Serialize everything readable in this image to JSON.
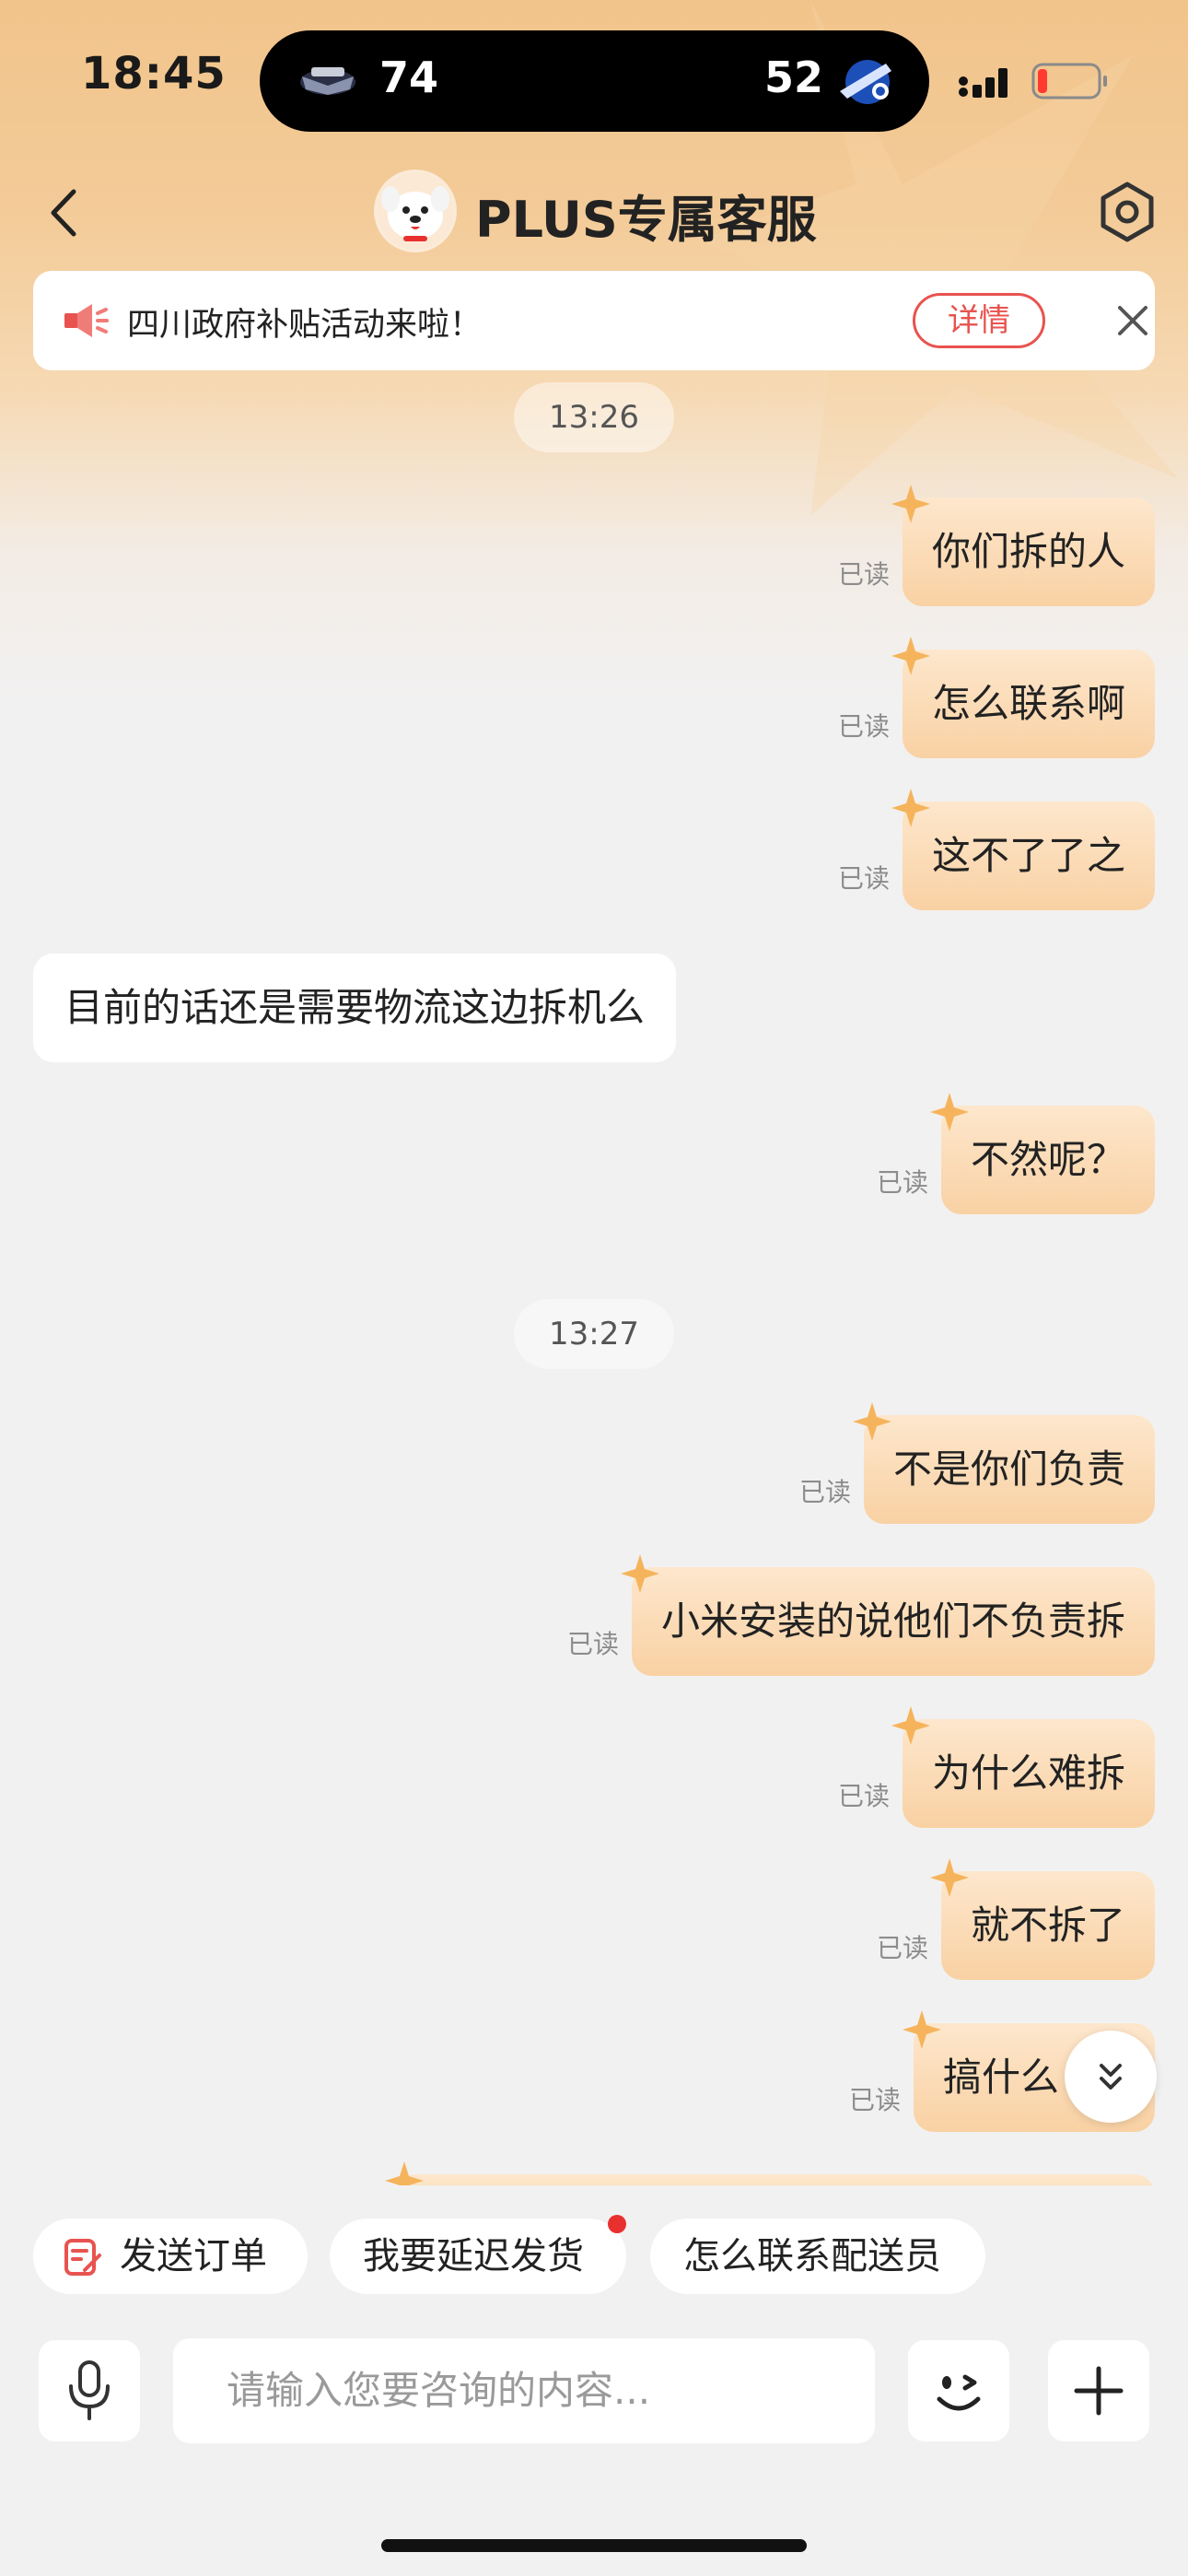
{
  "status_bar": {
    "time": "18:45",
    "live_activity": {
      "home_score": "74",
      "away_score": "52"
    }
  },
  "nav": {
    "title": "PLUS专属客服",
    "back_icon": "chevron-left-icon",
    "settings_icon": "hexagon-settings-icon"
  },
  "notice": {
    "text": "四川政府补贴活动来啦！",
    "detail_label": "详情",
    "icon": "megaphone-icon"
  },
  "messages": [
    {
      "type": "timestamp",
      "text": "13:26"
    },
    {
      "type": "out",
      "text": "你们拆的人",
      "read": "已读"
    },
    {
      "type": "out",
      "text": "怎么联系啊",
      "read": "已读"
    },
    {
      "type": "out",
      "text": "这不了了之",
      "read": "已读"
    },
    {
      "type": "in",
      "text": "目前的话还是需要物流这边拆机么"
    },
    {
      "type": "out",
      "text": "不然呢？",
      "read": "已读"
    },
    {
      "type": "timestamp",
      "text": "13:27"
    },
    {
      "type": "out",
      "text": "不是你们负责",
      "read": "已读"
    },
    {
      "type": "out",
      "text": "小米安装的说他们不负责拆",
      "read": "已读"
    },
    {
      "type": "out",
      "text": "为什么难拆",
      "read": "已读"
    },
    {
      "type": "out",
      "text": "就不拆了",
      "read": "已读"
    },
    {
      "type": "out",
      "text": "搞什么",
      "read": "已读"
    }
  ],
  "quick_replies": [
    {
      "label": "发送订单",
      "icon": "order-icon"
    },
    {
      "label": "我要延迟发货",
      "badge": true
    },
    {
      "label": "怎么联系配送员"
    }
  ],
  "input": {
    "placeholder": "请输入您要咨询的内容..."
  },
  "colors": {
    "accent_red": "#e8534f",
    "bubble_out_top": "#fde7cd",
    "bubble_out_bottom": "#f9d1a3",
    "header_orange": "#f1c48b"
  }
}
